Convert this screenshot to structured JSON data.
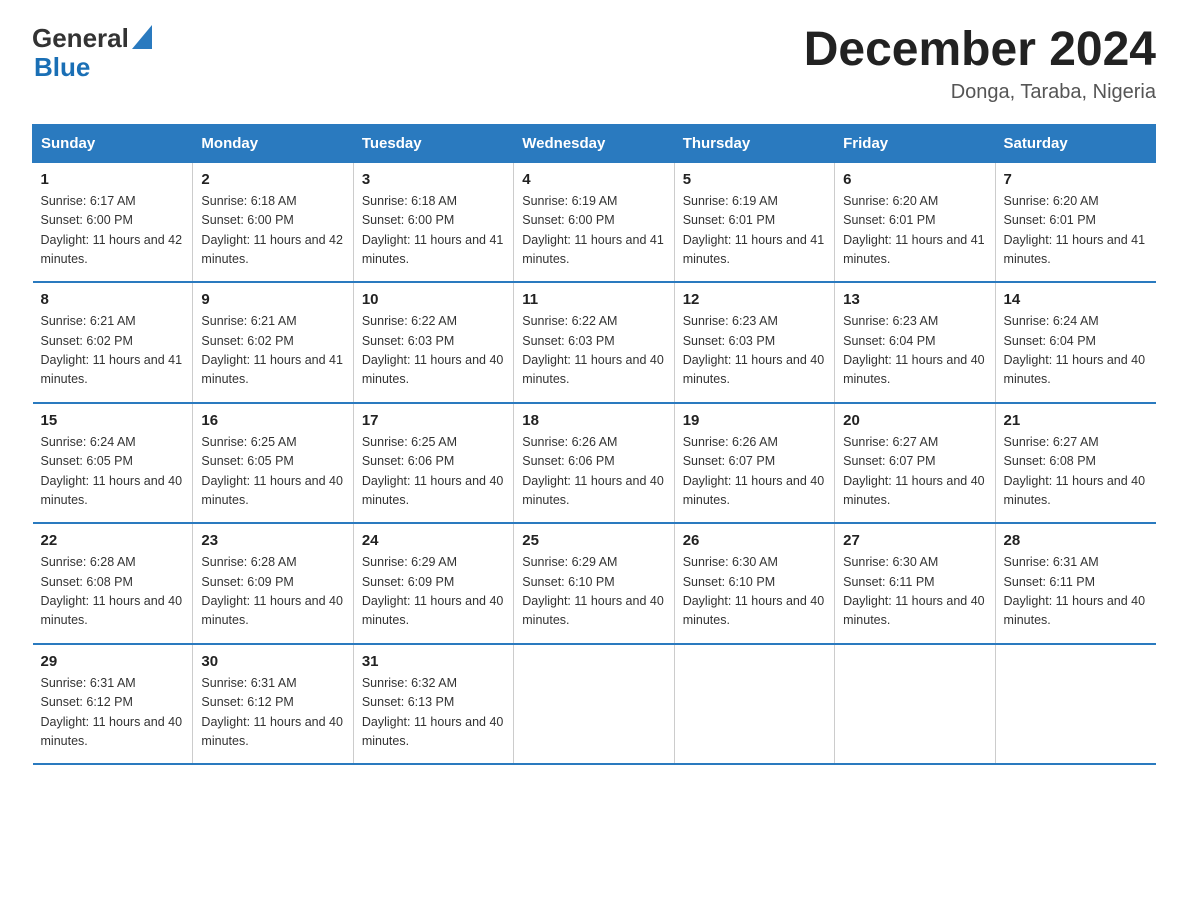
{
  "header": {
    "logo_general": "General",
    "logo_blue": "Blue",
    "month_title": "December 2024",
    "location": "Donga, Taraba, Nigeria"
  },
  "days_of_week": [
    "Sunday",
    "Monday",
    "Tuesday",
    "Wednesday",
    "Thursday",
    "Friday",
    "Saturday"
  ],
  "weeks": [
    [
      {
        "day": "1",
        "sunrise": "6:17 AM",
        "sunset": "6:00 PM",
        "daylight": "11 hours and 42 minutes."
      },
      {
        "day": "2",
        "sunrise": "6:18 AM",
        "sunset": "6:00 PM",
        "daylight": "11 hours and 42 minutes."
      },
      {
        "day": "3",
        "sunrise": "6:18 AM",
        "sunset": "6:00 PM",
        "daylight": "11 hours and 41 minutes."
      },
      {
        "day": "4",
        "sunrise": "6:19 AM",
        "sunset": "6:00 PM",
        "daylight": "11 hours and 41 minutes."
      },
      {
        "day": "5",
        "sunrise": "6:19 AM",
        "sunset": "6:01 PM",
        "daylight": "11 hours and 41 minutes."
      },
      {
        "day": "6",
        "sunrise": "6:20 AM",
        "sunset": "6:01 PM",
        "daylight": "11 hours and 41 minutes."
      },
      {
        "day": "7",
        "sunrise": "6:20 AM",
        "sunset": "6:01 PM",
        "daylight": "11 hours and 41 minutes."
      }
    ],
    [
      {
        "day": "8",
        "sunrise": "6:21 AM",
        "sunset": "6:02 PM",
        "daylight": "11 hours and 41 minutes."
      },
      {
        "day": "9",
        "sunrise": "6:21 AM",
        "sunset": "6:02 PM",
        "daylight": "11 hours and 41 minutes."
      },
      {
        "day": "10",
        "sunrise": "6:22 AM",
        "sunset": "6:03 PM",
        "daylight": "11 hours and 40 minutes."
      },
      {
        "day": "11",
        "sunrise": "6:22 AM",
        "sunset": "6:03 PM",
        "daylight": "11 hours and 40 minutes."
      },
      {
        "day": "12",
        "sunrise": "6:23 AM",
        "sunset": "6:03 PM",
        "daylight": "11 hours and 40 minutes."
      },
      {
        "day": "13",
        "sunrise": "6:23 AM",
        "sunset": "6:04 PM",
        "daylight": "11 hours and 40 minutes."
      },
      {
        "day": "14",
        "sunrise": "6:24 AM",
        "sunset": "6:04 PM",
        "daylight": "11 hours and 40 minutes."
      }
    ],
    [
      {
        "day": "15",
        "sunrise": "6:24 AM",
        "sunset": "6:05 PM",
        "daylight": "11 hours and 40 minutes."
      },
      {
        "day": "16",
        "sunrise": "6:25 AM",
        "sunset": "6:05 PM",
        "daylight": "11 hours and 40 minutes."
      },
      {
        "day": "17",
        "sunrise": "6:25 AM",
        "sunset": "6:06 PM",
        "daylight": "11 hours and 40 minutes."
      },
      {
        "day": "18",
        "sunrise": "6:26 AM",
        "sunset": "6:06 PM",
        "daylight": "11 hours and 40 minutes."
      },
      {
        "day": "19",
        "sunrise": "6:26 AM",
        "sunset": "6:07 PM",
        "daylight": "11 hours and 40 minutes."
      },
      {
        "day": "20",
        "sunrise": "6:27 AM",
        "sunset": "6:07 PM",
        "daylight": "11 hours and 40 minutes."
      },
      {
        "day": "21",
        "sunrise": "6:27 AM",
        "sunset": "6:08 PM",
        "daylight": "11 hours and 40 minutes."
      }
    ],
    [
      {
        "day": "22",
        "sunrise": "6:28 AM",
        "sunset": "6:08 PM",
        "daylight": "11 hours and 40 minutes."
      },
      {
        "day": "23",
        "sunrise": "6:28 AM",
        "sunset": "6:09 PM",
        "daylight": "11 hours and 40 minutes."
      },
      {
        "day": "24",
        "sunrise": "6:29 AM",
        "sunset": "6:09 PM",
        "daylight": "11 hours and 40 minutes."
      },
      {
        "day": "25",
        "sunrise": "6:29 AM",
        "sunset": "6:10 PM",
        "daylight": "11 hours and 40 minutes."
      },
      {
        "day": "26",
        "sunrise": "6:30 AM",
        "sunset": "6:10 PM",
        "daylight": "11 hours and 40 minutes."
      },
      {
        "day": "27",
        "sunrise": "6:30 AM",
        "sunset": "6:11 PM",
        "daylight": "11 hours and 40 minutes."
      },
      {
        "day": "28",
        "sunrise": "6:31 AM",
        "sunset": "6:11 PM",
        "daylight": "11 hours and 40 minutes."
      }
    ],
    [
      {
        "day": "29",
        "sunrise": "6:31 AM",
        "sunset": "6:12 PM",
        "daylight": "11 hours and 40 minutes."
      },
      {
        "day": "30",
        "sunrise": "6:31 AM",
        "sunset": "6:12 PM",
        "daylight": "11 hours and 40 minutes."
      },
      {
        "day": "31",
        "sunrise": "6:32 AM",
        "sunset": "6:13 PM",
        "daylight": "11 hours and 40 minutes."
      },
      null,
      null,
      null,
      null
    ]
  ],
  "labels": {
    "sunrise": "Sunrise:",
    "sunset": "Sunset:",
    "daylight": "Daylight:"
  }
}
